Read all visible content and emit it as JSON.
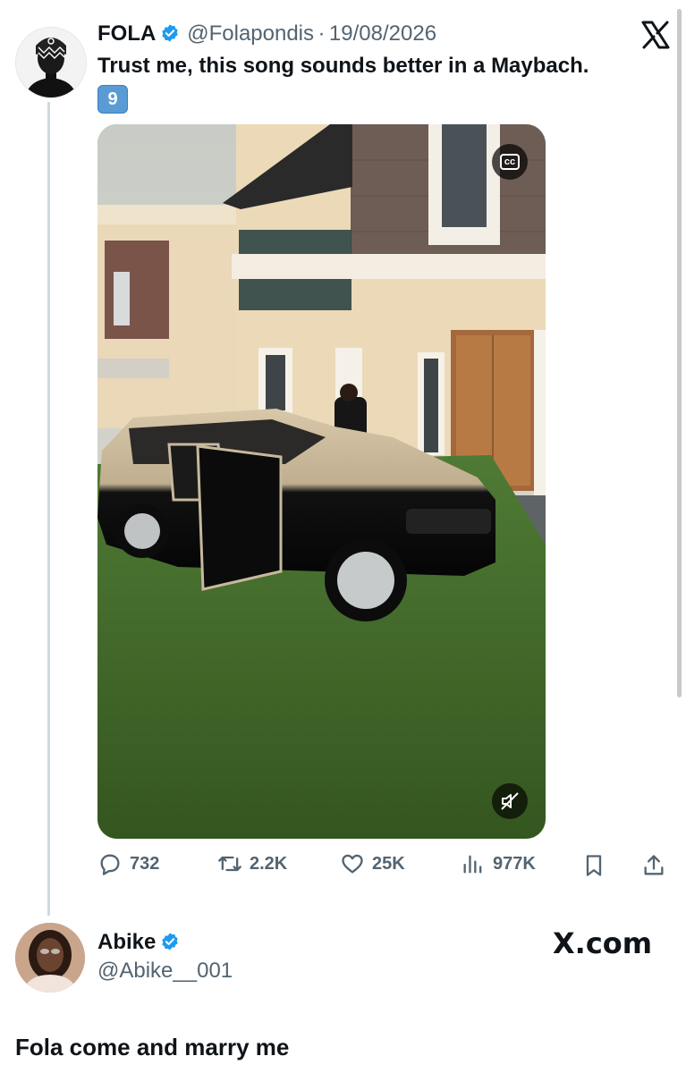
{
  "tweet": {
    "author_name": "FOLA",
    "handle": "@Folapondis",
    "separator": "·",
    "date": "19/08/2026",
    "text": "Trust me, this song sounds better in a Maybach.",
    "emoji": "9",
    "media": {
      "cc_label": "cc",
      "icons": [
        "closed-captions-icon",
        "mute-icon"
      ]
    },
    "actions": {
      "replies": "732",
      "reposts": "2.2K",
      "likes": "25K",
      "views": "977K"
    }
  },
  "reply": {
    "author_name": "Abike",
    "handle": "@Abike__001",
    "text": "Fola come and marry me",
    "watermark": "X.com"
  },
  "colors": {
    "verified": "#1d9bf0",
    "muted_text": "#536471",
    "thread_line": "#cfd9de"
  }
}
